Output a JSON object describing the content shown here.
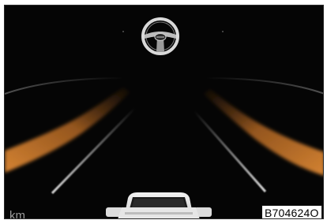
{
  "display": {
    "unit": "km",
    "image_code": "B704624O"
  },
  "icons": {
    "steering_wheel": "steering-wheel-icon",
    "vehicle": "car-rear-icon"
  },
  "colors": {
    "background": "#050505",
    "lane_glow": "#c8782c",
    "lane_line": "#bfbfbf",
    "wheel": "#d9d9d9"
  }
}
